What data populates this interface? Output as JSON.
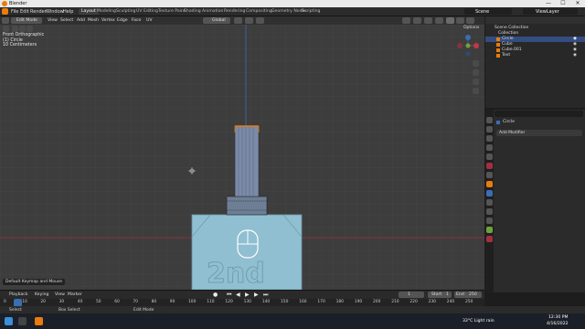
{
  "window": {
    "title": "Blender",
    "minimize": "—",
    "maximize": "☐",
    "close": "✕"
  },
  "menu": {
    "items": [
      "File",
      "Edit",
      "Render",
      "Window",
      "Help"
    ],
    "workspaces": [
      "Layout",
      "Modeling",
      "Sculpting",
      "UV Editing",
      "Texture Paint",
      "Shading",
      "Animation",
      "Rendering",
      "Compositing",
      "Geometry Nodes",
      "Scripting"
    ],
    "active_workspace": "Layout",
    "scene": "Scene",
    "view_layer": "ViewLayer"
  },
  "viewport_header": {
    "mode": "Edit Mode",
    "menus": [
      "View",
      "Select",
      "Add",
      "Mesh",
      "Vertex",
      "Edge",
      "Face",
      "UV"
    ],
    "transform_orientation": "Global",
    "options": "Options"
  },
  "viewport": {
    "view_name": "Front Orthographic",
    "object_name": "(1) Circle",
    "scale": "10 Centimeters",
    "emboss_text": "2nd",
    "gizmo_axes": [
      "X",
      "Y",
      "Z"
    ]
  },
  "outliner": {
    "root": "Scene Collection",
    "items": [
      {
        "name": "Collection",
        "level": 1
      },
      {
        "name": "Circle",
        "level": 2,
        "selected": true
      },
      {
        "name": "Cube",
        "level": 2
      },
      {
        "name": "Cube.001",
        "level": 2
      },
      {
        "name": "Text",
        "level": 2
      }
    ]
  },
  "properties": {
    "object_name": "Circle",
    "add_modifier": "Add Modifier"
  },
  "timeline": {
    "menus": [
      "Playback",
      "Keying",
      "View",
      "Marker"
    ],
    "current_frame": "1",
    "start_label": "Start",
    "start": "1",
    "end_label": "End",
    "end": "250",
    "ruler": [
      "0",
      "10",
      "20",
      "30",
      "40",
      "50",
      "60",
      "70",
      "80",
      "90",
      "100",
      "110",
      "120",
      "130",
      "140",
      "150",
      "160",
      "170",
      "180",
      "190",
      "200",
      "210",
      "220",
      "230",
      "240",
      "250"
    ]
  },
  "notification": "Default Keymap and Mouse",
  "statusbar": {
    "select": "Select",
    "box_select": "Box Select",
    "edit_mode": "Edit Mode"
  },
  "taskbar": {
    "weather": "33°C  Light rain",
    "time": "12:30 PM",
    "date": "4/16/2022"
  },
  "colors": {
    "accent": "#e87d0d",
    "selection": "#334d80",
    "x_axis": "#c0394b",
    "y_axis": "#6ea33c",
    "z_axis": "#3b6db3",
    "mesh_face": "#8fbfd0"
  }
}
